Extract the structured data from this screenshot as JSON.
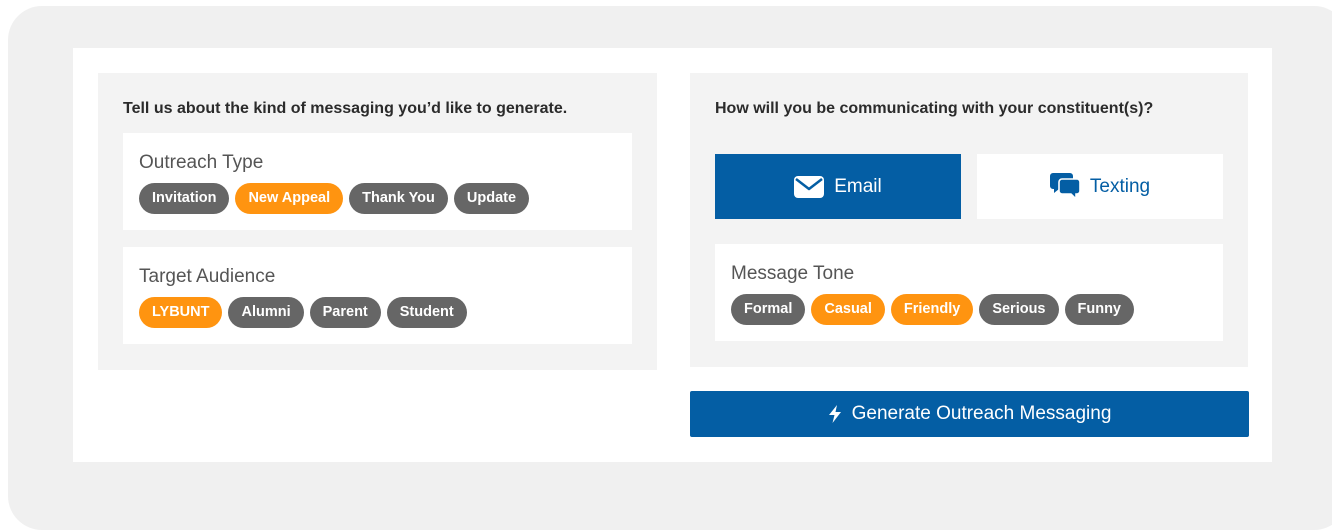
{
  "outreach_section": {
    "prompt": "Tell us about the kind of messaging you’d like to generate.",
    "outreach_type": {
      "title": "Outreach Type",
      "chips": [
        {
          "label": "Invitation",
          "selected": false
        },
        {
          "label": "New Appeal",
          "selected": true
        },
        {
          "label": "Thank You",
          "selected": false
        },
        {
          "label": "Update",
          "selected": false
        }
      ]
    },
    "target_audience": {
      "title": "Target Audience",
      "chips": [
        {
          "label": "LYBUNT",
          "selected": true
        },
        {
          "label": "Alumni",
          "selected": false
        },
        {
          "label": "Parent",
          "selected": false
        },
        {
          "label": "Student",
          "selected": false
        }
      ]
    }
  },
  "communication_section": {
    "prompt": "How will you be communicating with your constituent(s)?",
    "channels": {
      "email": {
        "label": "Email",
        "icon": "envelope-icon",
        "selected": true
      },
      "texting": {
        "label": "Texting",
        "icon": "chat-bubbles-icon",
        "selected": false
      }
    },
    "message_tone": {
      "title": "Message Tone",
      "chips": [
        {
          "label": "Formal",
          "selected": false
        },
        {
          "label": "Casual",
          "selected": true
        },
        {
          "label": "Friendly",
          "selected": true
        },
        {
          "label": "Serious",
          "selected": false
        },
        {
          "label": "Funny",
          "selected": false
        }
      ]
    }
  },
  "generate_button": {
    "label": "Generate Outreach Messaging",
    "icon": "lightning-bolt-icon"
  },
  "colors": {
    "primary_blue": "#045ea4",
    "selected_orange": "#ff9410",
    "unselected_gray": "#666666",
    "panel_gray": "#f3f3f3"
  }
}
